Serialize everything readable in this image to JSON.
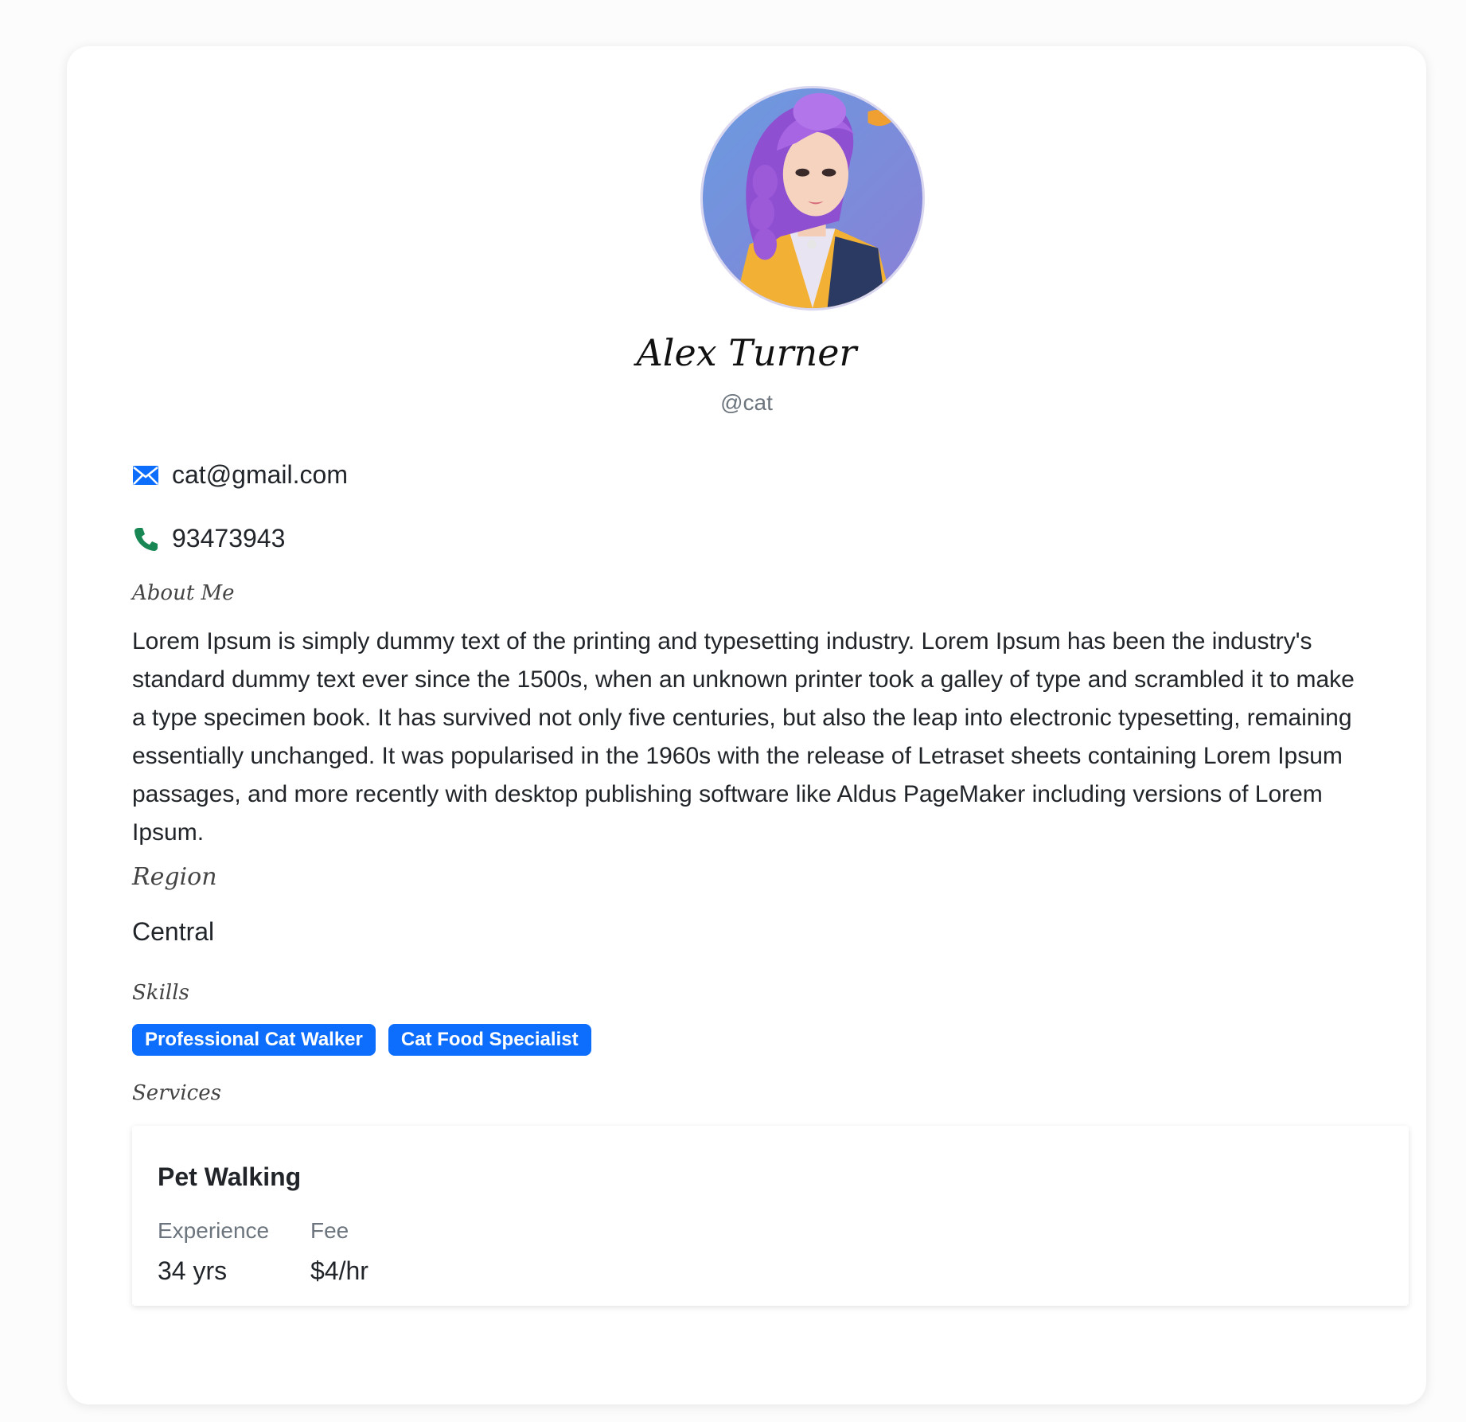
{
  "profile": {
    "name": "Alex Turner",
    "handle": "@cat",
    "email": "cat@gmail.com",
    "phone": "93473943",
    "avatar_icon": "avatar-illustration-purple-hair"
  },
  "about": {
    "label": "About Me",
    "text": "Lorem Ipsum is simply dummy text of the printing and typesetting industry. Lorem Ipsum has been the industry's standard dummy text ever since the 1500s, when an unknown printer took a galley of type and scrambled it to make a type specimen book. It has survived not only five centuries, but also the leap into electronic typesetting, remaining essentially unchanged. It was popularised in the 1960s with the release of Letraset sheets containing Lorem Ipsum passages, and more recently with desktop publishing software like Aldus PageMaker including versions of Lorem Ipsum."
  },
  "region": {
    "label": "Region",
    "value": "Central"
  },
  "skills": {
    "label": "Skills",
    "items": [
      "Professional Cat Walker",
      "Cat Food Specialist"
    ]
  },
  "services": {
    "label": "Services",
    "items": [
      {
        "title": "Pet Walking",
        "experience_label": "Experience",
        "experience_value": "34 yrs",
        "fee_label": "Fee",
        "fee_value": "$4/hr"
      }
    ]
  },
  "colors": {
    "accent": "#0d6efd",
    "phone_icon": "#198754",
    "email_icon": "#0d6efd"
  }
}
